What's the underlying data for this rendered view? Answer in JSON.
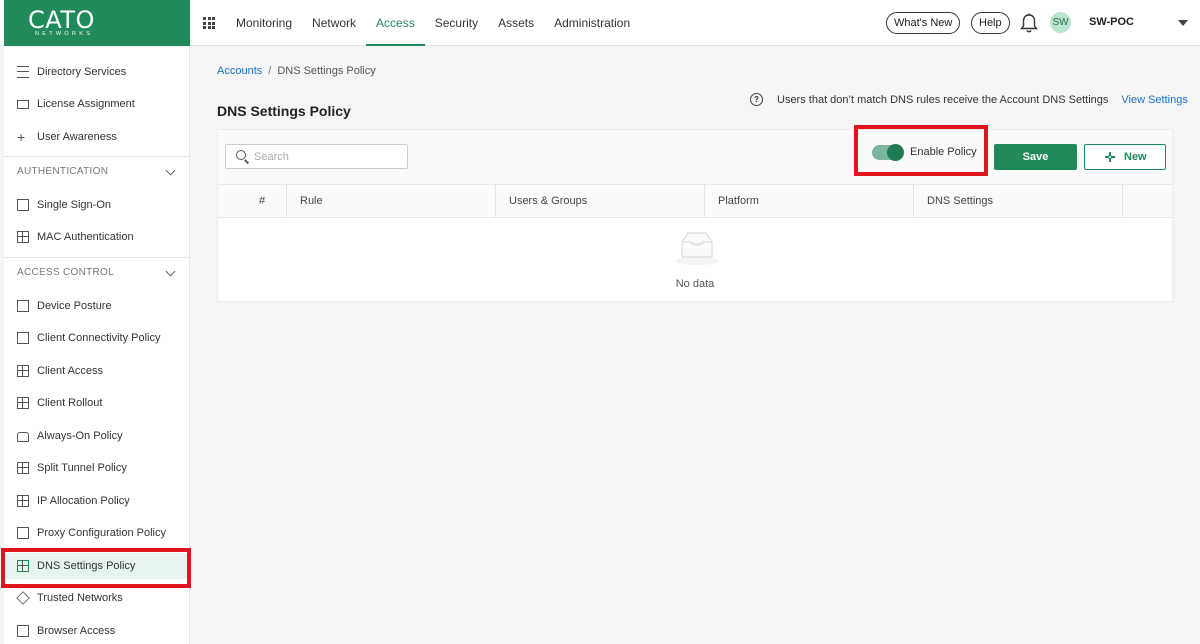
{
  "header": {
    "logo": "CATO",
    "logo_sub": "NETWORKS",
    "nav": [
      "Monitoring",
      "Network",
      "Access",
      "Security",
      "Assets",
      "Administration"
    ],
    "active_nav": "Access",
    "whats_new": "What's New",
    "help": "Help",
    "avatar_initials": "SW",
    "account": "SW-POC"
  },
  "sidebar": {
    "top_items": [
      "Directory Services",
      "License Assignment",
      "User Awareness"
    ],
    "sections": [
      {
        "title": "AUTHENTICATION",
        "items": [
          "Single Sign-On",
          "MAC Authentication"
        ]
      },
      {
        "title": "ACCESS CONTROL",
        "items": [
          "Device Posture",
          "Client Connectivity Policy",
          "Client Access",
          "Client Rollout",
          "Always-On Policy",
          "Split Tunnel Policy",
          "IP Allocation Policy",
          "Proxy Configuration Policy",
          "DNS Settings Policy",
          "Trusted Networks",
          "Browser Access"
        ]
      }
    ],
    "selected": "DNS Settings Policy"
  },
  "breadcrumb": {
    "root": "Accounts",
    "separator": "/",
    "current": "DNS Settings Policy"
  },
  "page": {
    "title": "DNS Settings Policy",
    "info_icon": "?",
    "info_text": "Users that don’t match DNS rules receive the Account DNS Settings",
    "view_settings": "View Settings"
  },
  "toolbar": {
    "search_placeholder": "Search",
    "enable_policy": "Enable Policy",
    "enable_policy_on": true,
    "save": "Save",
    "new": "New"
  },
  "table": {
    "columns": [
      "#",
      "Rule",
      "Users & Groups",
      "Platform",
      "DNS Settings"
    ],
    "empty_text": "No data"
  },
  "colors": {
    "brand": "#218a5b",
    "link": "#1a73c9",
    "highlight": "#e0141e"
  }
}
